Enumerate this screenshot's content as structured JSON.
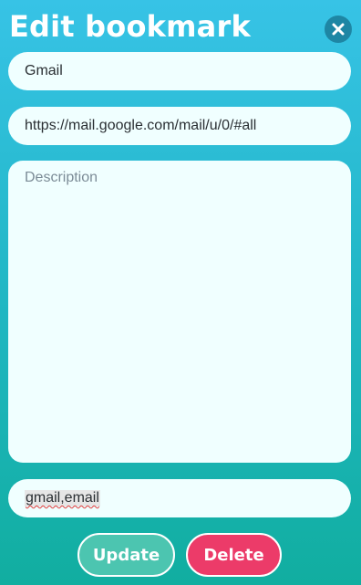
{
  "dialog": {
    "title": "Edit bookmark",
    "close_icon": "close-icon"
  },
  "form": {
    "name_value": "Gmail",
    "url_value": "https://mail.google.com/mail/u/0/#all",
    "description_value": "",
    "description_placeholder": "Description",
    "tags_value": "gmail,email"
  },
  "actions": {
    "update_label": "Update",
    "delete_label": "Delete"
  },
  "colors": {
    "gradient_top": "#37c3e6",
    "gradient_bottom": "#11aea0",
    "field_bg": "#f0ffff",
    "close_bg": "#1e86a4",
    "update_bg": "#4cc5b0",
    "delete_bg": "#ec3b69"
  }
}
